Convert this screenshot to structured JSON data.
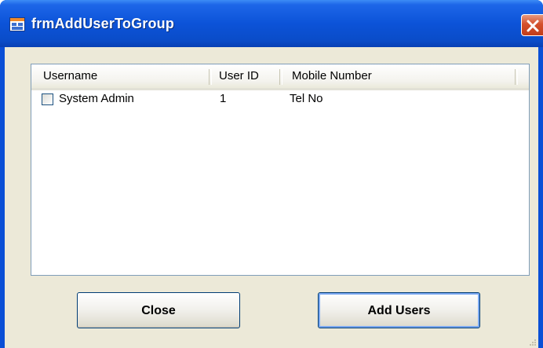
{
  "window": {
    "title": "frmAddUserToGroup",
    "close_icon": "close-x-icon",
    "app_icon": "form-icon"
  },
  "listview": {
    "columns": [
      {
        "label": "Username"
      },
      {
        "label": "User ID"
      },
      {
        "label": "Mobile Number"
      }
    ],
    "rows": [
      {
        "checked": false,
        "username": "System Admin",
        "user_id": "1",
        "mobile": "Tel No"
      }
    ]
  },
  "buttons": {
    "close_label": "Close",
    "add_users_label": "Add Users"
  },
  "colors": {
    "titlebar": "#0a4fd6",
    "client_bg": "#ece9d8",
    "close_button": "#d4502c"
  }
}
